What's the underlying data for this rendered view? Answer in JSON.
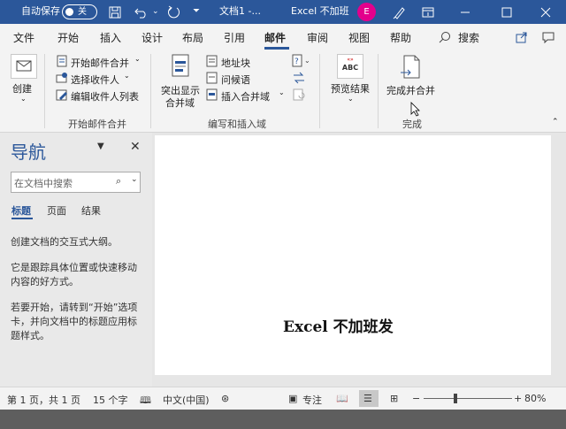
{
  "titlebar": {
    "autosave_label": "自动保存",
    "autosave_state": "关",
    "doc_name": "文档1 -...",
    "app_title": "Excel 不加班",
    "avatar_initial": "E"
  },
  "tabs": [
    "文件",
    "开始",
    "插入",
    "设计",
    "布局",
    "引用",
    "邮件",
    "审阅",
    "视图",
    "帮助"
  ],
  "active_tab": "邮件",
  "tell_me": "搜索",
  "ribbon": {
    "create": {
      "label": "创建"
    },
    "start_merge": {
      "items": [
        "开始邮件合并",
        "选择收件人",
        "编辑收件人列表"
      ],
      "group_label": "开始邮件合并"
    },
    "write_insert": {
      "highlight_label_1": "突出显示",
      "highlight_label_2": "合并域",
      "items": [
        "地址块",
        "问候语",
        "插入合并域"
      ],
      "group_label": "编写和插入域"
    },
    "preview": {
      "label": "预览结果",
      "abc": "ABC"
    },
    "finish": {
      "label": "完成并合并",
      "group_label": "完成"
    }
  },
  "nav": {
    "title": "导航",
    "search_placeholder": "在文档中搜索",
    "tabs": [
      "标题",
      "页面",
      "结果"
    ],
    "para1": "创建文档的交互式大纲。",
    "para2": "它是跟踪具体位置或快速移动内容的好方式。",
    "para3": "若要开始，请转到“开始”选项卡，并向文档中的标题应用标题样式。"
  },
  "document": {
    "text": "Excel 不加班发"
  },
  "status": {
    "page": "第 1 页，共 1 页",
    "words": "15 个字",
    "lang": "中文(中国)",
    "focus": "专注",
    "zoom": "80%",
    "zoom_level": 0.8
  },
  "colors": {
    "accent": "#2b579a",
    "avatar": "#e3008c"
  }
}
